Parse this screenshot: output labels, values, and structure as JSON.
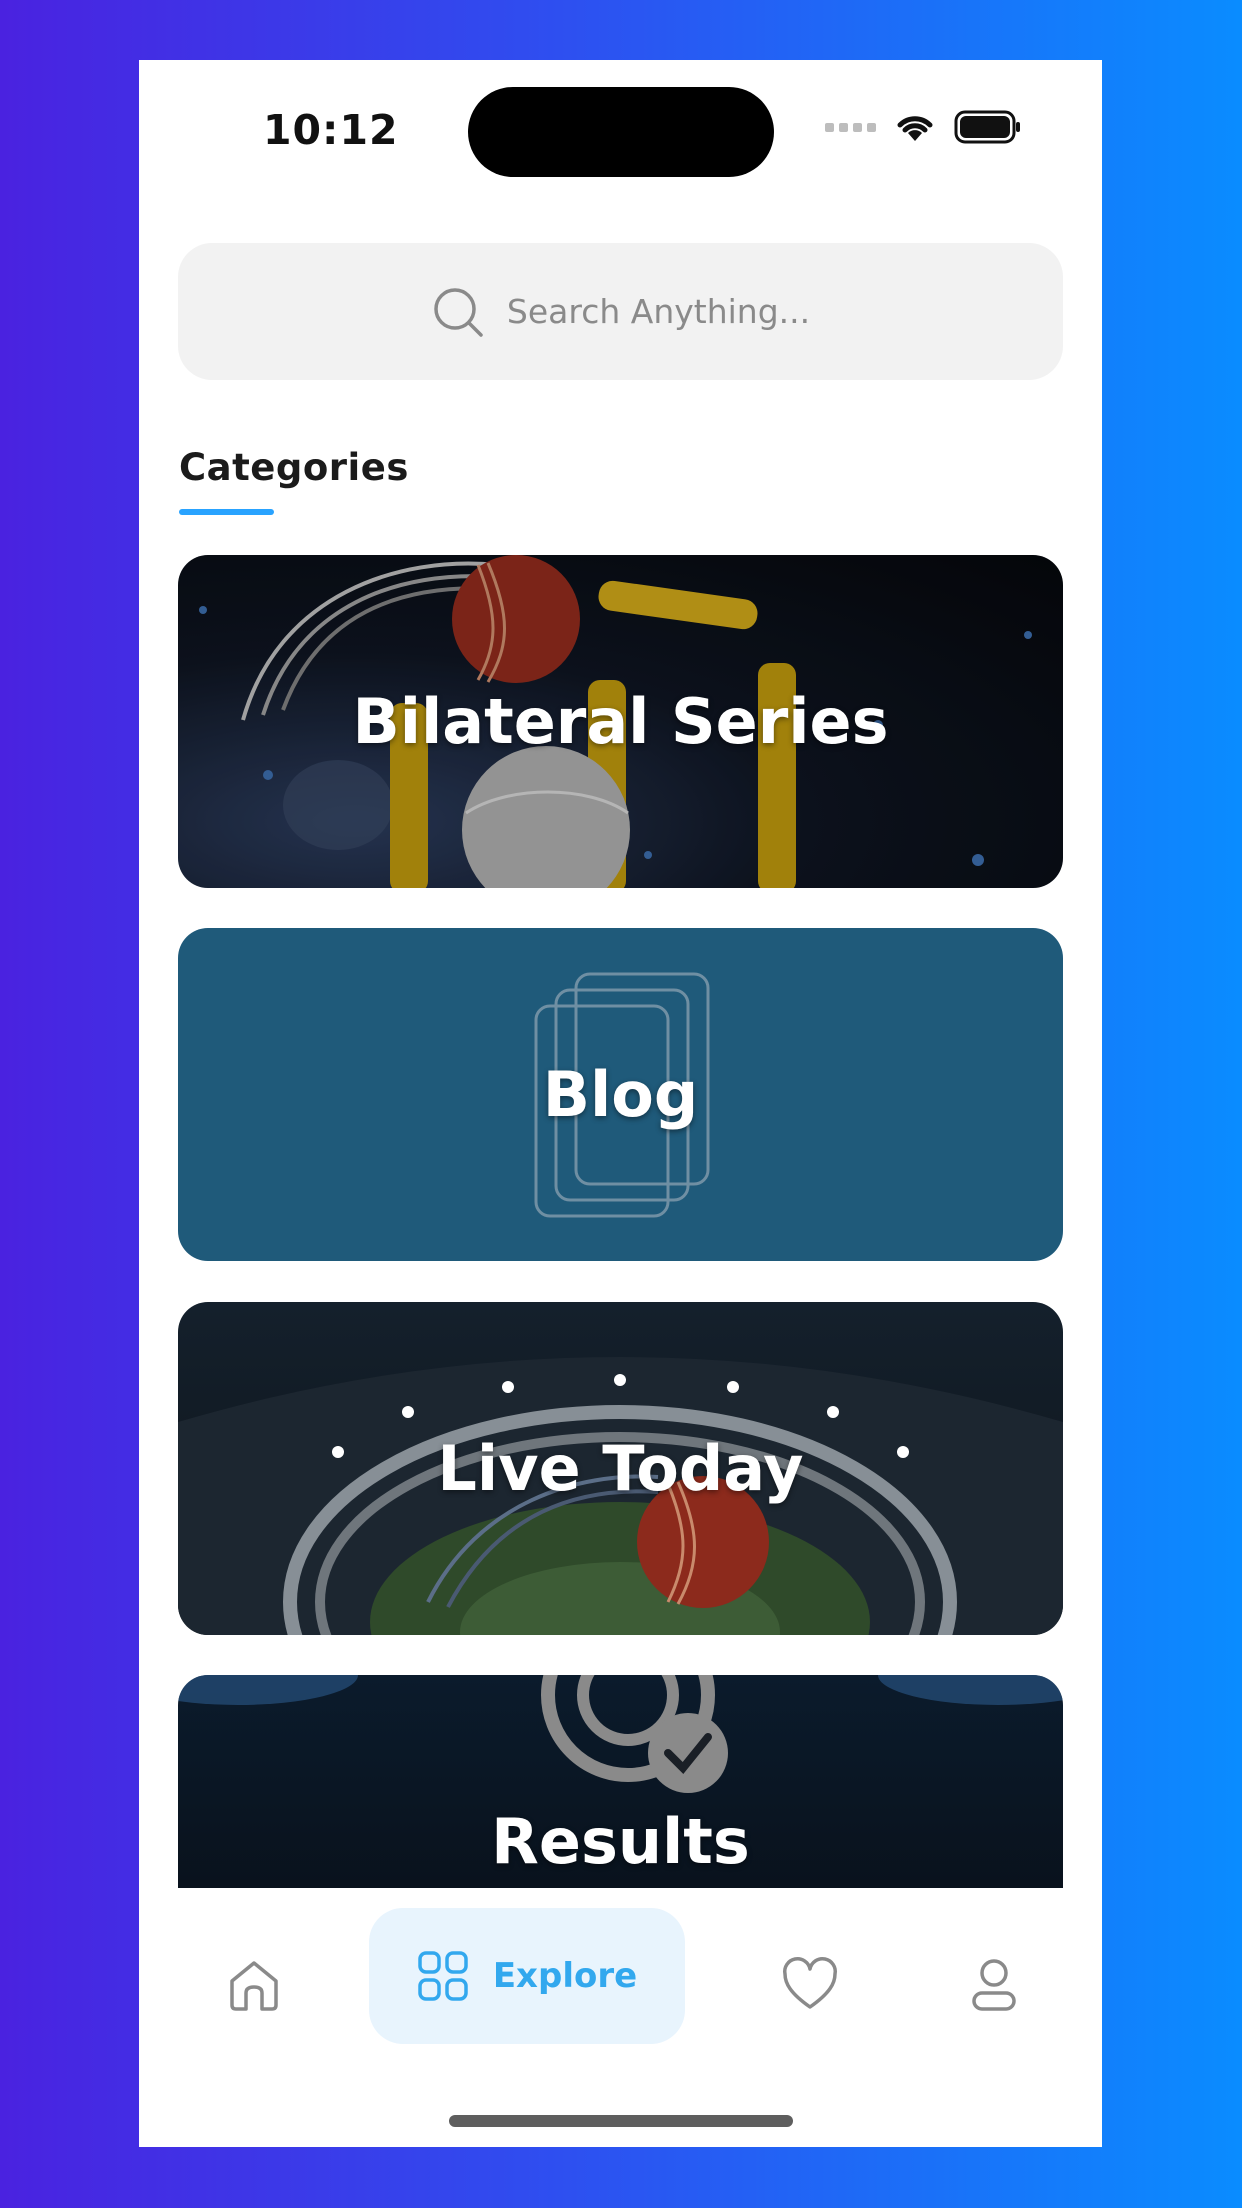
{
  "status_bar": {
    "time": "10:12"
  },
  "search": {
    "placeholder": "Search Anything..."
  },
  "section": {
    "title": "Categories"
  },
  "categories": [
    {
      "label": "Bilateral Series"
    },
    {
      "label": "Blog"
    },
    {
      "label": "Live Today"
    },
    {
      "label": "Results"
    }
  ],
  "bottom_nav": {
    "items": [
      {
        "icon": "home-icon",
        "label": ""
      },
      {
        "icon": "grid-icon",
        "label": "Explore"
      },
      {
        "icon": "heart-icon",
        "label": ""
      },
      {
        "icon": "user-icon",
        "label": ""
      }
    ],
    "active_index": 1
  },
  "colors": {
    "accent": "#29a3ff",
    "explore_bg": "#e8f4fd",
    "blog_card": "#1f5a7a",
    "background_gradient_start": "#4a22e0",
    "background_gradient_end": "#0a8cff"
  }
}
